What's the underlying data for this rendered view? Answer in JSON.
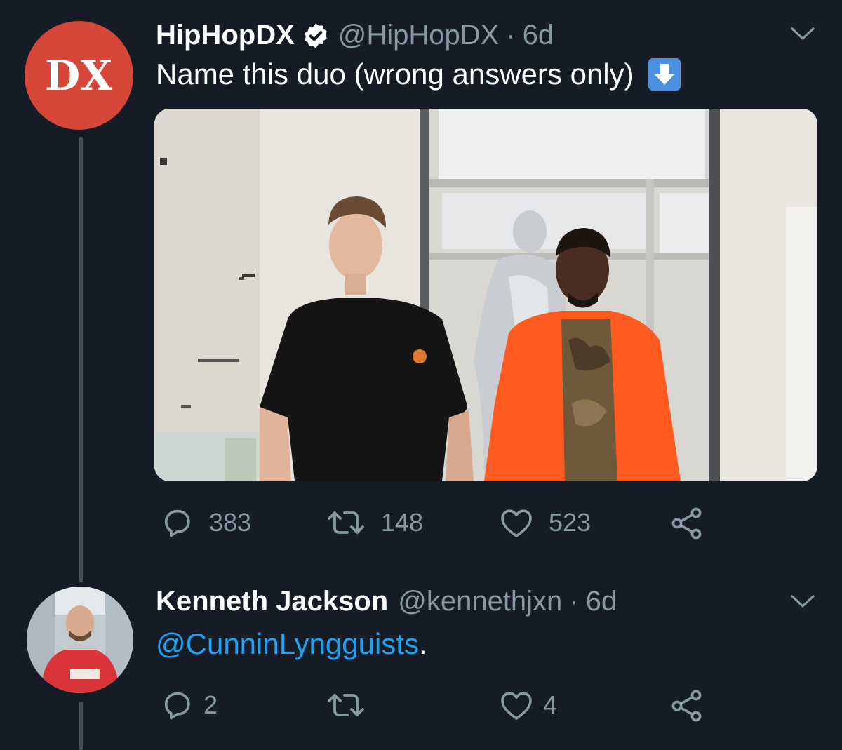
{
  "tweet1": {
    "avatar_text": "DX",
    "name": "HipHopDX",
    "handle": "@HipHopDX",
    "separator": "·",
    "time": "6d",
    "text": "Name this duo (wrong answers only)",
    "emoji": "down-arrow-emoji",
    "media_icon": "photo",
    "actions": {
      "replies": "383",
      "retweets": "148",
      "likes": "523"
    }
  },
  "tweet2": {
    "name": "Kenneth Jackson",
    "handle": "@kennethjxn",
    "separator": "·",
    "time": "6d",
    "mention": "@CunninLyngguists",
    "after_mention": ".",
    "actions": {
      "replies": "2",
      "retweets": "",
      "likes": "4"
    }
  },
  "colors": {
    "background": "#151c26",
    "muted": "#8899a6",
    "link": "#1da1f2",
    "dx_red": "#d6473a",
    "thread_line": "#42505f"
  }
}
